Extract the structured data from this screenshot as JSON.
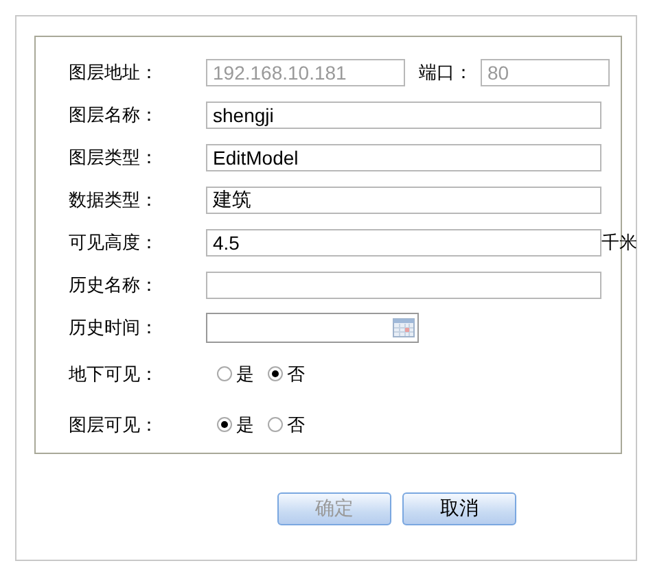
{
  "form": {
    "rows": [
      {
        "kind": "address",
        "label": "图层地址：",
        "value": "192.168.10.181",
        "disabled": true,
        "port_label": "端口：",
        "port_value": "80",
        "port_disabled": true
      },
      {
        "kind": "input",
        "label": "图层名称：",
        "value": "shengji"
      },
      {
        "kind": "input",
        "label": "图层类型：",
        "value": "EditModel"
      },
      {
        "kind": "input",
        "label": "数据类型：",
        "value": "建筑"
      },
      {
        "kind": "input",
        "label": "可见高度：",
        "value": "4.5",
        "unit": "千米"
      },
      {
        "kind": "input",
        "label": "历史名称："
      },
      {
        "kind": "date",
        "label": "历史时间："
      },
      {
        "kind": "radio",
        "label": "地下可见：",
        "options": [
          {
            "label": "是",
            "selected": false
          },
          {
            "label": "否",
            "selected": true
          }
        ]
      },
      {
        "kind": "radio",
        "label": "图层可见：",
        "options": [
          {
            "label": "是",
            "selected": true
          },
          {
            "label": "否",
            "selected": false
          }
        ]
      }
    ]
  },
  "buttons": [
    {
      "label": "确定",
      "disabled": true
    },
    {
      "label": "取消",
      "disabled": false
    }
  ]
}
